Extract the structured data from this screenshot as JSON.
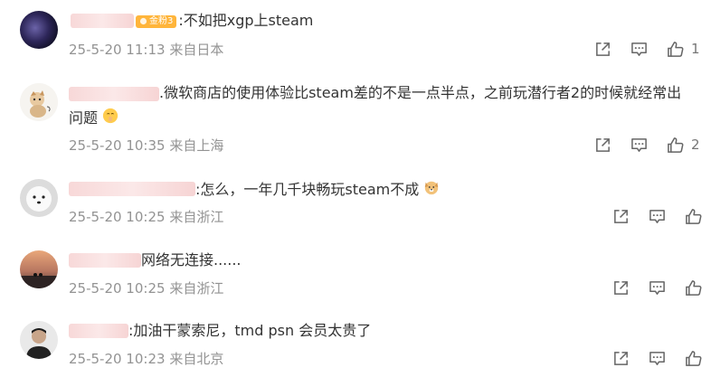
{
  "comments": [
    {
      "text": ":不如把xgp上steam",
      "badge": "金粉3",
      "time": "25-5-20 11:13",
      "source": "来自日本",
      "like_count": "1"
    },
    {
      "text_line1": ".微软商店的使用体验比steam差的不是一点半点，之前玩潜行者2的时候就经常出",
      "text_line2": "问题",
      "emoji": "shushing-face",
      "time": "25-5-20 10:35",
      "source": "来自上海",
      "like_count": "2"
    },
    {
      "text": ":怎么，一年几千块畅玩steam不成",
      "emoji": "dog-face",
      "time": "25-5-20 10:25",
      "source": "来自浙江"
    },
    {
      "text": "网络无连接......",
      "time": "25-5-20 10:25",
      "source": "来自浙江"
    },
    {
      "text": ":加油干蒙索尼，tmd psn 会员太贵了",
      "time": "25-5-20 10:23",
      "source": "来自北京"
    }
  ],
  "icons": {
    "share": "share-icon",
    "comment": "comment-icon",
    "like": "thumbs-up-icon"
  },
  "colors": {
    "meta_text": "#939393",
    "badge": "#ffb53b",
    "icon": "#666666"
  }
}
